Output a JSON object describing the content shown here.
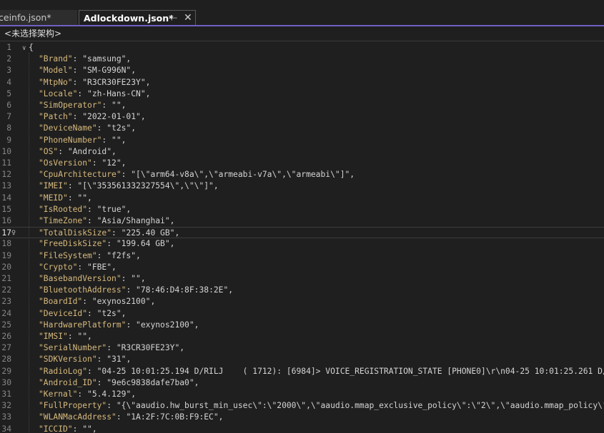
{
  "tabs": [
    {
      "label": "ceinfo.json*",
      "active": false
    },
    {
      "label": "Adlockdown.json*",
      "active": true,
      "pin_icon": "pin-icon",
      "close_icon": "close-icon"
    }
  ],
  "nav": {
    "label": "<未选择架构>"
  },
  "colors": {
    "accent": "#7160c4",
    "key": "#d7ba7d",
    "string": "#d4d4d4",
    "background": "#1f1f1f"
  },
  "editor": {
    "current_line": 17,
    "lines": [
      {
        "n": "1",
        "text": "{"
      },
      {
        "n": "2",
        "key": "\"Brand\"",
        "value": "\"samsung\","
      },
      {
        "n": "3",
        "key": "\"Model\"",
        "value": "\"SM-G996N\","
      },
      {
        "n": "4",
        "key": "\"MtpNo\"",
        "value": "\"R3CR30FE23Y\","
      },
      {
        "n": "5",
        "key": "\"Locale\"",
        "value": "\"zh-Hans-CN\","
      },
      {
        "n": "6",
        "key": "\"SimOperator\"",
        "value": "\"\","
      },
      {
        "n": "7",
        "key": "\"Patch\"",
        "value": "\"2022-01-01\","
      },
      {
        "n": "8",
        "key": "\"DeviceName\"",
        "value": "\"t2s\","
      },
      {
        "n": "9",
        "key": "\"PhoneNumber\"",
        "value": "\"\","
      },
      {
        "n": "10",
        "key": "\"OS\"",
        "value": "\"Android\","
      },
      {
        "n": "11",
        "key": "\"OsVersion\"",
        "value": "\"12\","
      },
      {
        "n": "12",
        "key": "\"CpuArchitecture\"",
        "value": "\"[\\\"arm64-v8a\\\",\\\"armeabi-v7a\\\",\\\"armeabi\\\"]\","
      },
      {
        "n": "13",
        "key": "\"IMEI\"",
        "value": "\"[\\\"353561332327554\\\",\\\"\\\"]\","
      },
      {
        "n": "14",
        "key": "\"MEID\"",
        "value": "\"\","
      },
      {
        "n": "15",
        "key": "\"IsRooted\"",
        "value": "\"true\","
      },
      {
        "n": "16",
        "key": "\"TimeZone\"",
        "value": "\"Asia/Shanghai\","
      },
      {
        "n": "17",
        "key": "\"TotalDiskSize\"",
        "value": "\"225.40 GB\","
      },
      {
        "n": "18",
        "key": "\"FreeDiskSize\"",
        "value": "\"199.64 GB\","
      },
      {
        "n": "19",
        "key": "\"FileSystem\"",
        "value": "\"f2fs\","
      },
      {
        "n": "20",
        "key": "\"Crypto\"",
        "value": "\"FBE\","
      },
      {
        "n": "21",
        "key": "\"BasebandVersion\"",
        "value": "\"\","
      },
      {
        "n": "22",
        "key": "\"BluetoothAddress\"",
        "value": "\"78:46:D4:8F:38:2E\","
      },
      {
        "n": "23",
        "key": "\"BoardId\"",
        "value": "\"exynos2100\","
      },
      {
        "n": "24",
        "key": "\"DeviceId\"",
        "value": "\"t2s\","
      },
      {
        "n": "25",
        "key": "\"HardwarePlatform\"",
        "value": "\"exynos2100\","
      },
      {
        "n": "26",
        "key": "\"IMSI\"",
        "value": "\"\","
      },
      {
        "n": "27",
        "key": "\"SerialNumber\"",
        "value": "\"R3CR30FE23Y\","
      },
      {
        "n": "28",
        "key": "\"SDKVersion\"",
        "value": "\"31\","
      },
      {
        "n": "29",
        "key": "\"RadioLog\"",
        "value": "\"04-25 10:01:25.194 D/RILJ    ( 1712): [6984]> VOICE_REGISTRATION_STATE [PHONE0]\\r\\n04-25 10:01:25.261 D/"
      },
      {
        "n": "30",
        "key": "\"Android_ID\"",
        "value": "\"9e6c9838dafe7ba0\","
      },
      {
        "n": "31",
        "key": "\"Kernal\"",
        "value": "\"5.4.129\","
      },
      {
        "n": "32",
        "key": "\"FullProperty\"",
        "value": "\"{\\\"aaudio.hw_burst_min_usec\\\":\\\"2000\\\",\\\"aaudio.mmap_exclusive_policy\\\":\\\"2\\\",\\\"aaudio.mmap_policy\\\":"
      },
      {
        "n": "33",
        "key": "\"WLANMacAddress\"",
        "value": "\"1A:2F:7C:0B:F9:EC\","
      },
      {
        "n": "34",
        "key": "\"ICCID\"",
        "value": "\"\","
      }
    ]
  }
}
